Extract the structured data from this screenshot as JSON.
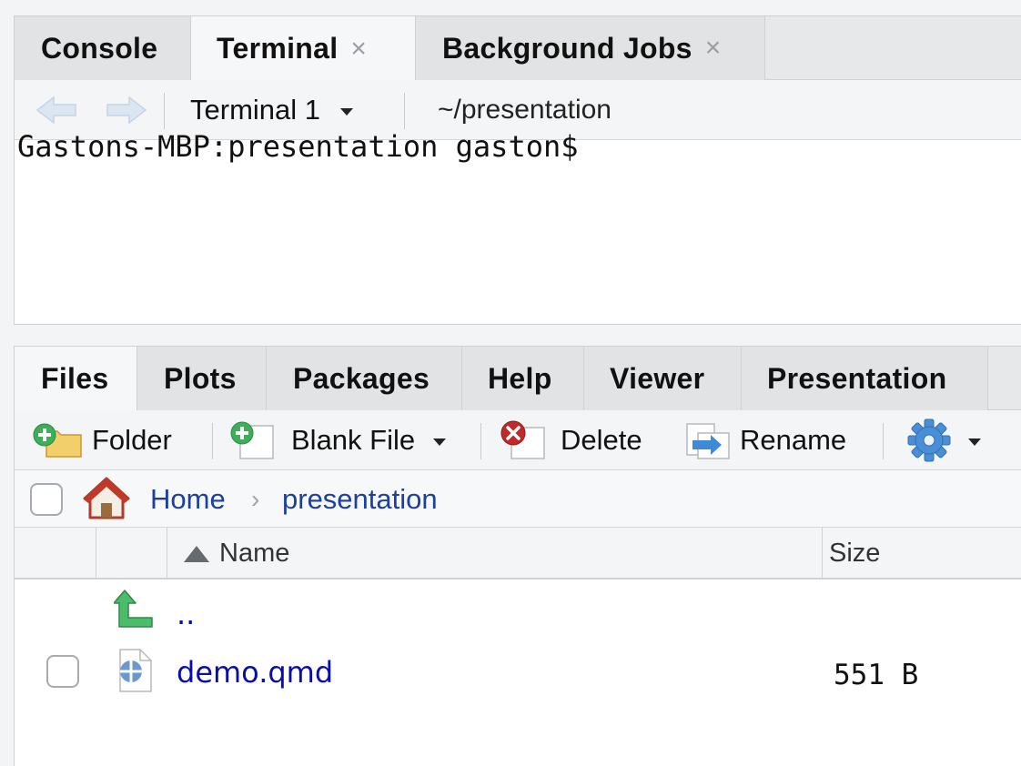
{
  "top_pane": {
    "tabs": [
      {
        "label": "Console",
        "active": false,
        "closable": false
      },
      {
        "label": "Terminal",
        "active": true,
        "closable": true
      },
      {
        "label": "Background Jobs",
        "active": false,
        "closable": true
      }
    ],
    "close_glyph": "×",
    "terminal_selector": "Terminal 1",
    "working_dir": "~/presentation",
    "prompt": "Gastons-MBP:presentation gaston$"
  },
  "bottom_pane": {
    "tabs": [
      {
        "label": "Files",
        "active": true
      },
      {
        "label": "Plots",
        "active": false
      },
      {
        "label": "Packages",
        "active": false
      },
      {
        "label": "Help",
        "active": false
      },
      {
        "label": "Viewer",
        "active": false
      },
      {
        "label": "Presentation",
        "active": false
      }
    ],
    "toolbar": {
      "new_folder": "Folder",
      "blank_file": "Blank File",
      "delete": "Delete",
      "rename": "Rename"
    },
    "breadcrumb": {
      "home": "Home",
      "current": "presentation",
      "separator": "›"
    },
    "columns": {
      "name": "Name",
      "size": "Size"
    },
    "files": [
      {
        "name": "..",
        "size": ""
      },
      {
        "name": "demo.qmd",
        "size": "551 B"
      }
    ]
  },
  "colors": {
    "link": "#0a0ea8",
    "breadcrumb": "#1c3fa0",
    "up_arrow": "#4cbb6a",
    "delete_red": "#c0282a",
    "gear_blue": "#4a8fd6"
  }
}
